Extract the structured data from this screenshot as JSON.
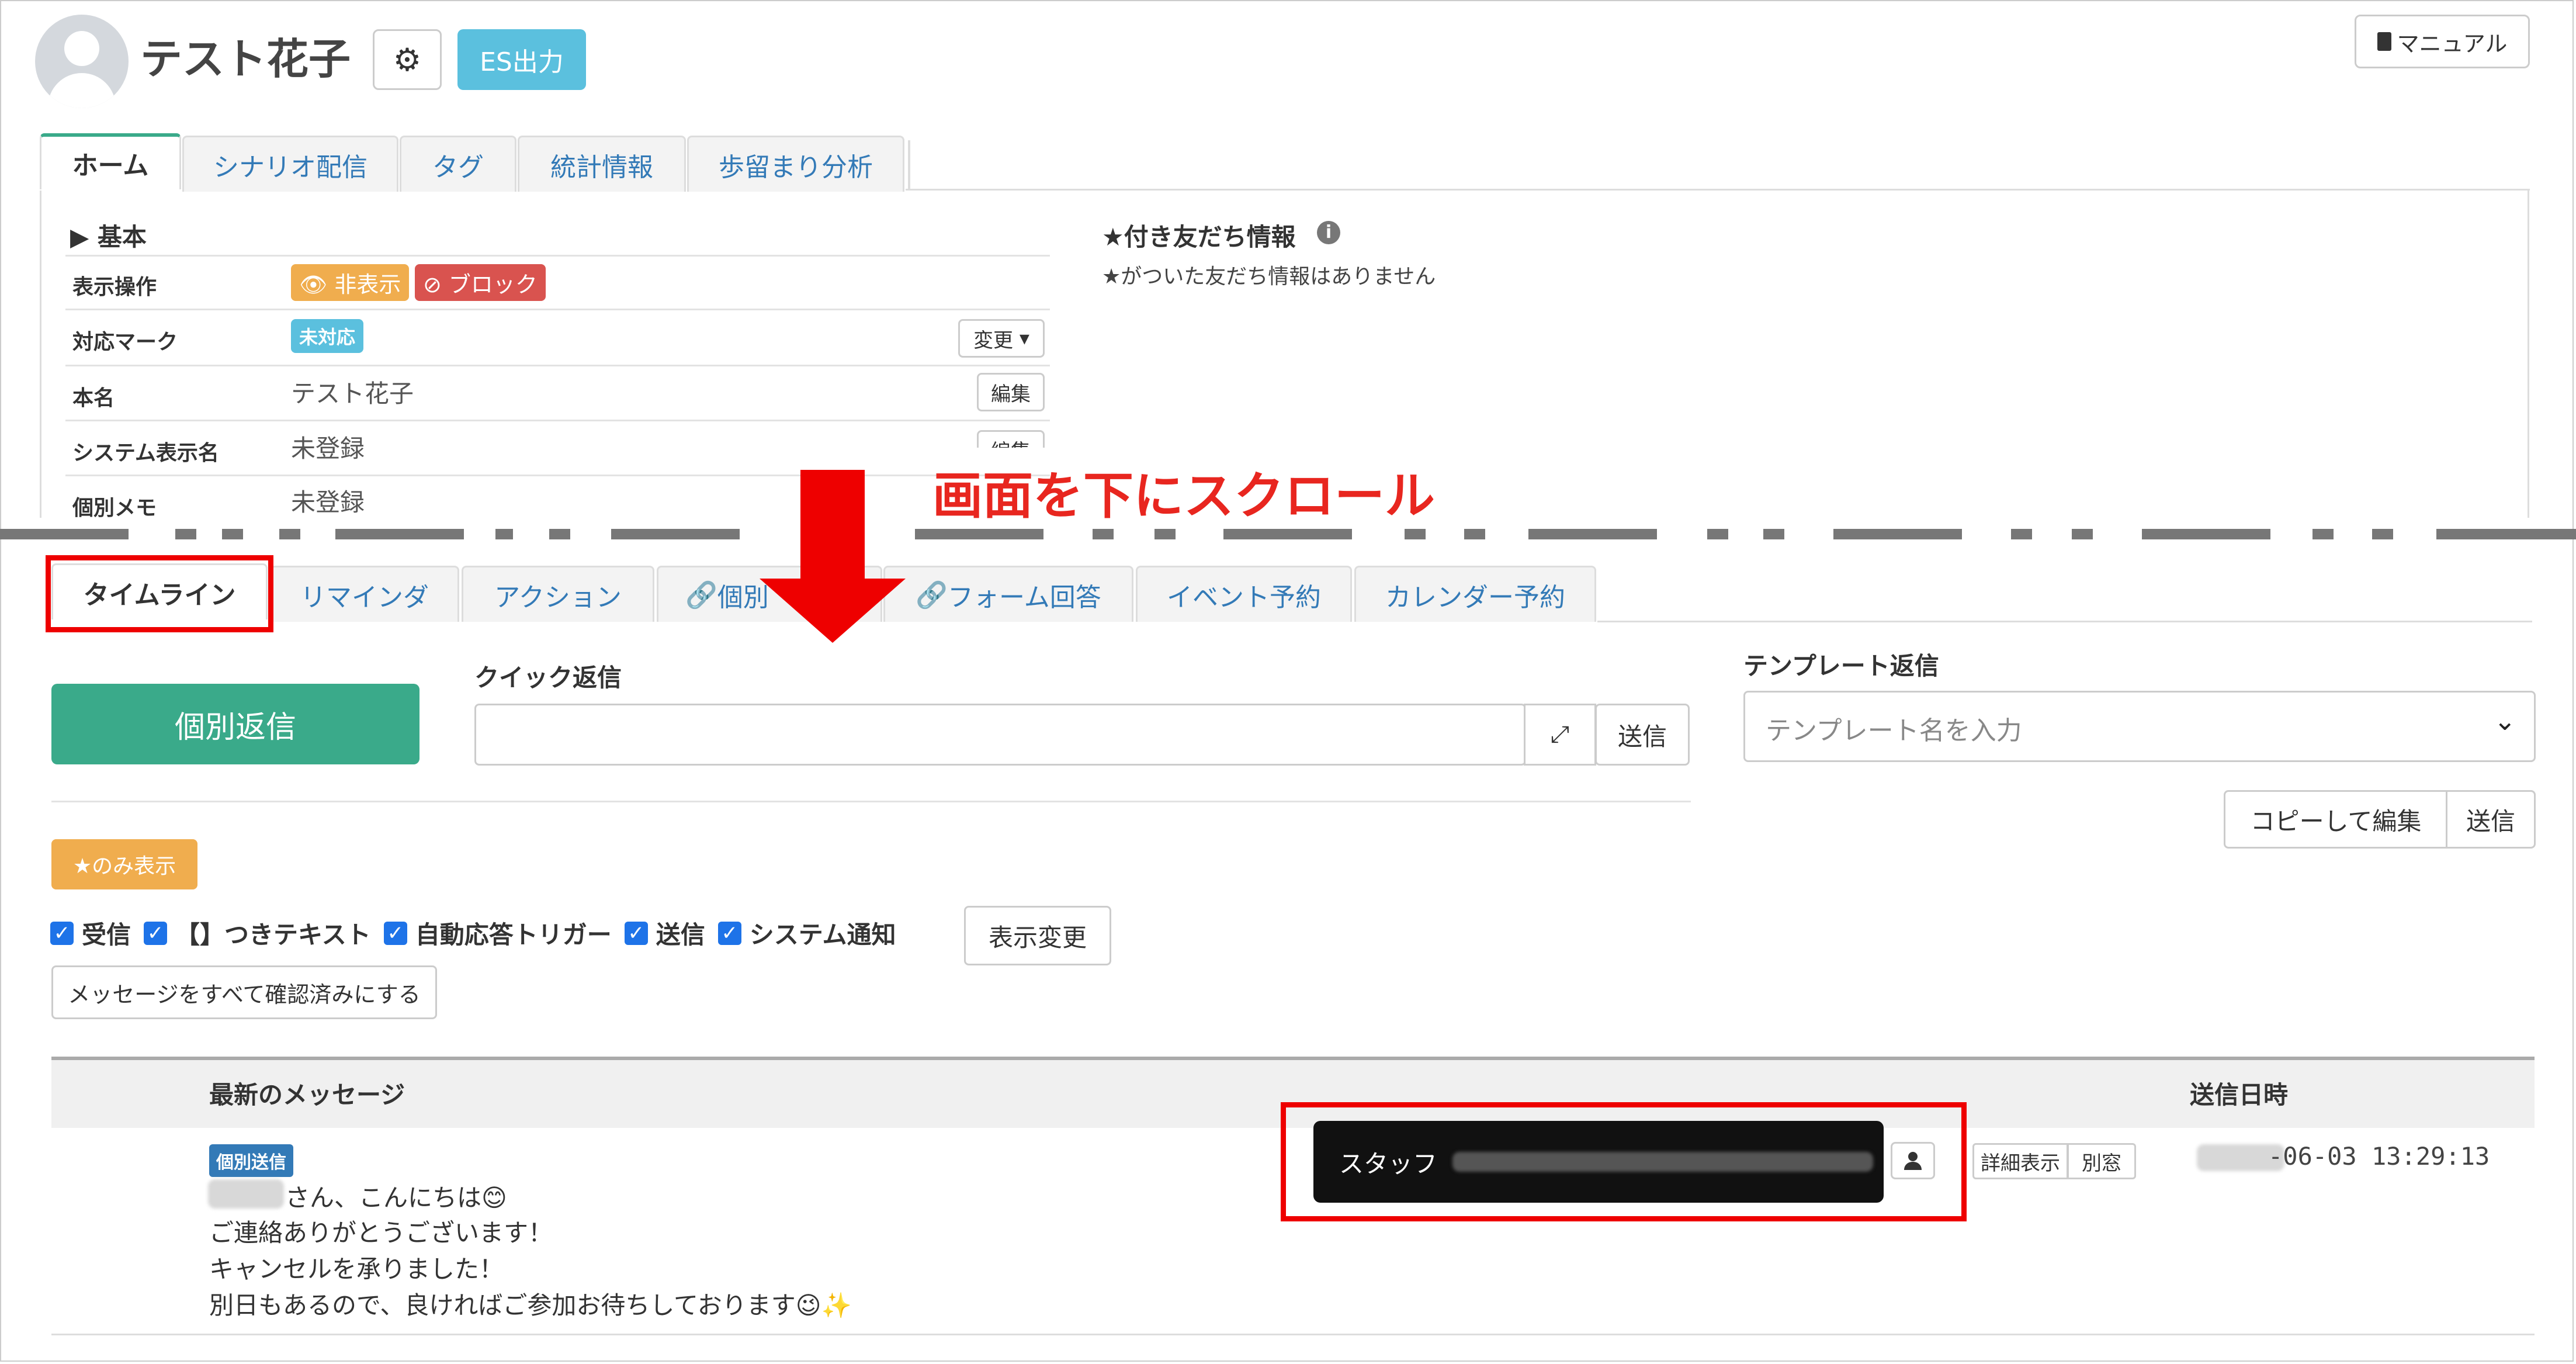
{
  "header": {
    "user_name": "テスト花子",
    "settings_icon": "gear-icon",
    "es_button": "ES出力",
    "manual_button": "マニュアル"
  },
  "top_tabs": [
    "ホーム",
    "シナリオ配信",
    "タグ",
    "統計情報",
    "歩留まり分析"
  ],
  "basic": {
    "title": "▶ 基本",
    "rows": [
      {
        "label": "表示操作",
        "hide_badge": "非表示",
        "block_badge": "ブロック"
      },
      {
        "label": "対応マーク",
        "status_badge": "未対応",
        "button": "変更"
      },
      {
        "label": "本名",
        "value": "テスト花子",
        "button": "編集"
      },
      {
        "label": "システム表示名",
        "value": "未登録",
        "button": "編集"
      },
      {
        "label": "個別メモ",
        "value": "未登録"
      }
    ]
  },
  "starred": {
    "title": "★付き友だち情報",
    "info_icon": "info-icon",
    "empty_text": "★がついた友だち情報はありません"
  },
  "annotation": {
    "scroll_text": "画面を下にスクロール",
    "arrow_icon": "down-arrow-icon"
  },
  "timeline_tabs": [
    "タイムライン",
    "リマインダ",
    "アクション",
    "個別",
    "フォーム回答",
    "イベント予約",
    "カレンダー予約"
  ],
  "timeline": {
    "reply_button": "個別返信",
    "quick_reply_label": "クイック返信",
    "quick_send": "送信",
    "template_label": "テンプレート返信",
    "template_placeholder": "テンプレート名を入力",
    "copy_edit": "コピーして編集",
    "template_send": "送信",
    "star_only": "★のみ表示",
    "filters": [
      "受信",
      "【】つきテキスト",
      "自動応答トリガー",
      "送信",
      "システム通知"
    ],
    "apply_button": "表示変更",
    "mark_all_read": "メッセージをすべて確認済みにする"
  },
  "messages_table": {
    "col_message": "最新のメッセージ",
    "col_date": "送信日時",
    "row": {
      "type_badge": "個別送信",
      "lines": [
        "さん、こんにちは😊",
        "ご連絡ありがとうございます！",
        "キャンセルを承りました！",
        "別日もあるので、良ければご参加お待ちしております😉✨"
      ],
      "staff_label": "スタッフ",
      "detail_button": "詳細表示",
      "window_button": "別窓",
      "sent_at": "-06-03 13:29:13"
    }
  },
  "colors": {
    "accent_green": "#3aaa8a",
    "info_blue": "#5bc0de",
    "warning_orange": "#f0ad4e",
    "danger_red": "#d9534f",
    "annotation_red": "#e00000"
  }
}
